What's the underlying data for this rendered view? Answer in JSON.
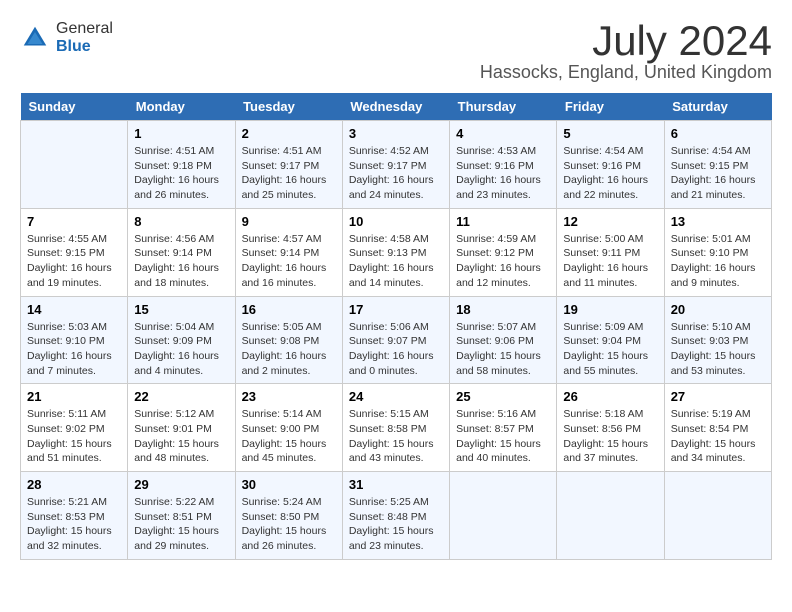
{
  "logo": {
    "general": "General",
    "blue": "Blue"
  },
  "title": "July 2024",
  "location": "Hassocks, England, United Kingdom",
  "headers": [
    "Sunday",
    "Monday",
    "Tuesday",
    "Wednesday",
    "Thursday",
    "Friday",
    "Saturday"
  ],
  "weeks": [
    [
      {
        "day": "",
        "sunrise": "",
        "sunset": "",
        "daylight": ""
      },
      {
        "day": "1",
        "sunrise": "Sunrise: 4:51 AM",
        "sunset": "Sunset: 9:18 PM",
        "daylight": "Daylight: 16 hours and 26 minutes."
      },
      {
        "day": "2",
        "sunrise": "Sunrise: 4:51 AM",
        "sunset": "Sunset: 9:17 PM",
        "daylight": "Daylight: 16 hours and 25 minutes."
      },
      {
        "day": "3",
        "sunrise": "Sunrise: 4:52 AM",
        "sunset": "Sunset: 9:17 PM",
        "daylight": "Daylight: 16 hours and 24 minutes."
      },
      {
        "day": "4",
        "sunrise": "Sunrise: 4:53 AM",
        "sunset": "Sunset: 9:16 PM",
        "daylight": "Daylight: 16 hours and 23 minutes."
      },
      {
        "day": "5",
        "sunrise": "Sunrise: 4:54 AM",
        "sunset": "Sunset: 9:16 PM",
        "daylight": "Daylight: 16 hours and 22 minutes."
      },
      {
        "day": "6",
        "sunrise": "Sunrise: 4:54 AM",
        "sunset": "Sunset: 9:15 PM",
        "daylight": "Daylight: 16 hours and 21 minutes."
      }
    ],
    [
      {
        "day": "7",
        "sunrise": "Sunrise: 4:55 AM",
        "sunset": "Sunset: 9:15 PM",
        "daylight": "Daylight: 16 hours and 19 minutes."
      },
      {
        "day": "8",
        "sunrise": "Sunrise: 4:56 AM",
        "sunset": "Sunset: 9:14 PM",
        "daylight": "Daylight: 16 hours and 18 minutes."
      },
      {
        "day": "9",
        "sunrise": "Sunrise: 4:57 AM",
        "sunset": "Sunset: 9:14 PM",
        "daylight": "Daylight: 16 hours and 16 minutes."
      },
      {
        "day": "10",
        "sunrise": "Sunrise: 4:58 AM",
        "sunset": "Sunset: 9:13 PM",
        "daylight": "Daylight: 16 hours and 14 minutes."
      },
      {
        "day": "11",
        "sunrise": "Sunrise: 4:59 AM",
        "sunset": "Sunset: 9:12 PM",
        "daylight": "Daylight: 16 hours and 12 minutes."
      },
      {
        "day": "12",
        "sunrise": "Sunrise: 5:00 AM",
        "sunset": "Sunset: 9:11 PM",
        "daylight": "Daylight: 16 hours and 11 minutes."
      },
      {
        "day": "13",
        "sunrise": "Sunrise: 5:01 AM",
        "sunset": "Sunset: 9:10 PM",
        "daylight": "Daylight: 16 hours and 9 minutes."
      }
    ],
    [
      {
        "day": "14",
        "sunrise": "Sunrise: 5:03 AM",
        "sunset": "Sunset: 9:10 PM",
        "daylight": "Daylight: 16 hours and 7 minutes."
      },
      {
        "day": "15",
        "sunrise": "Sunrise: 5:04 AM",
        "sunset": "Sunset: 9:09 PM",
        "daylight": "Daylight: 16 hours and 4 minutes."
      },
      {
        "day": "16",
        "sunrise": "Sunrise: 5:05 AM",
        "sunset": "Sunset: 9:08 PM",
        "daylight": "Daylight: 16 hours and 2 minutes."
      },
      {
        "day": "17",
        "sunrise": "Sunrise: 5:06 AM",
        "sunset": "Sunset: 9:07 PM",
        "daylight": "Daylight: 16 hours and 0 minutes."
      },
      {
        "day": "18",
        "sunrise": "Sunrise: 5:07 AM",
        "sunset": "Sunset: 9:06 PM",
        "daylight": "Daylight: 15 hours and 58 minutes."
      },
      {
        "day": "19",
        "sunrise": "Sunrise: 5:09 AM",
        "sunset": "Sunset: 9:04 PM",
        "daylight": "Daylight: 15 hours and 55 minutes."
      },
      {
        "day": "20",
        "sunrise": "Sunrise: 5:10 AM",
        "sunset": "Sunset: 9:03 PM",
        "daylight": "Daylight: 15 hours and 53 minutes."
      }
    ],
    [
      {
        "day": "21",
        "sunrise": "Sunrise: 5:11 AM",
        "sunset": "Sunset: 9:02 PM",
        "daylight": "Daylight: 15 hours and 51 minutes."
      },
      {
        "day": "22",
        "sunrise": "Sunrise: 5:12 AM",
        "sunset": "Sunset: 9:01 PM",
        "daylight": "Daylight: 15 hours and 48 minutes."
      },
      {
        "day": "23",
        "sunrise": "Sunrise: 5:14 AM",
        "sunset": "Sunset: 9:00 PM",
        "daylight": "Daylight: 15 hours and 45 minutes."
      },
      {
        "day": "24",
        "sunrise": "Sunrise: 5:15 AM",
        "sunset": "Sunset: 8:58 PM",
        "daylight": "Daylight: 15 hours and 43 minutes."
      },
      {
        "day": "25",
        "sunrise": "Sunrise: 5:16 AM",
        "sunset": "Sunset: 8:57 PM",
        "daylight": "Daylight: 15 hours and 40 minutes."
      },
      {
        "day": "26",
        "sunrise": "Sunrise: 5:18 AM",
        "sunset": "Sunset: 8:56 PM",
        "daylight": "Daylight: 15 hours and 37 minutes."
      },
      {
        "day": "27",
        "sunrise": "Sunrise: 5:19 AM",
        "sunset": "Sunset: 8:54 PM",
        "daylight": "Daylight: 15 hours and 34 minutes."
      }
    ],
    [
      {
        "day": "28",
        "sunrise": "Sunrise: 5:21 AM",
        "sunset": "Sunset: 8:53 PM",
        "daylight": "Daylight: 15 hours and 32 minutes."
      },
      {
        "day": "29",
        "sunrise": "Sunrise: 5:22 AM",
        "sunset": "Sunset: 8:51 PM",
        "daylight": "Daylight: 15 hours and 29 minutes."
      },
      {
        "day": "30",
        "sunrise": "Sunrise: 5:24 AM",
        "sunset": "Sunset: 8:50 PM",
        "daylight": "Daylight: 15 hours and 26 minutes."
      },
      {
        "day": "31",
        "sunrise": "Sunrise: 5:25 AM",
        "sunset": "Sunset: 8:48 PM",
        "daylight": "Daylight: 15 hours and 23 minutes."
      },
      {
        "day": "",
        "sunrise": "",
        "sunset": "",
        "daylight": ""
      },
      {
        "day": "",
        "sunrise": "",
        "sunset": "",
        "daylight": ""
      },
      {
        "day": "",
        "sunrise": "",
        "sunset": "",
        "daylight": ""
      }
    ]
  ]
}
